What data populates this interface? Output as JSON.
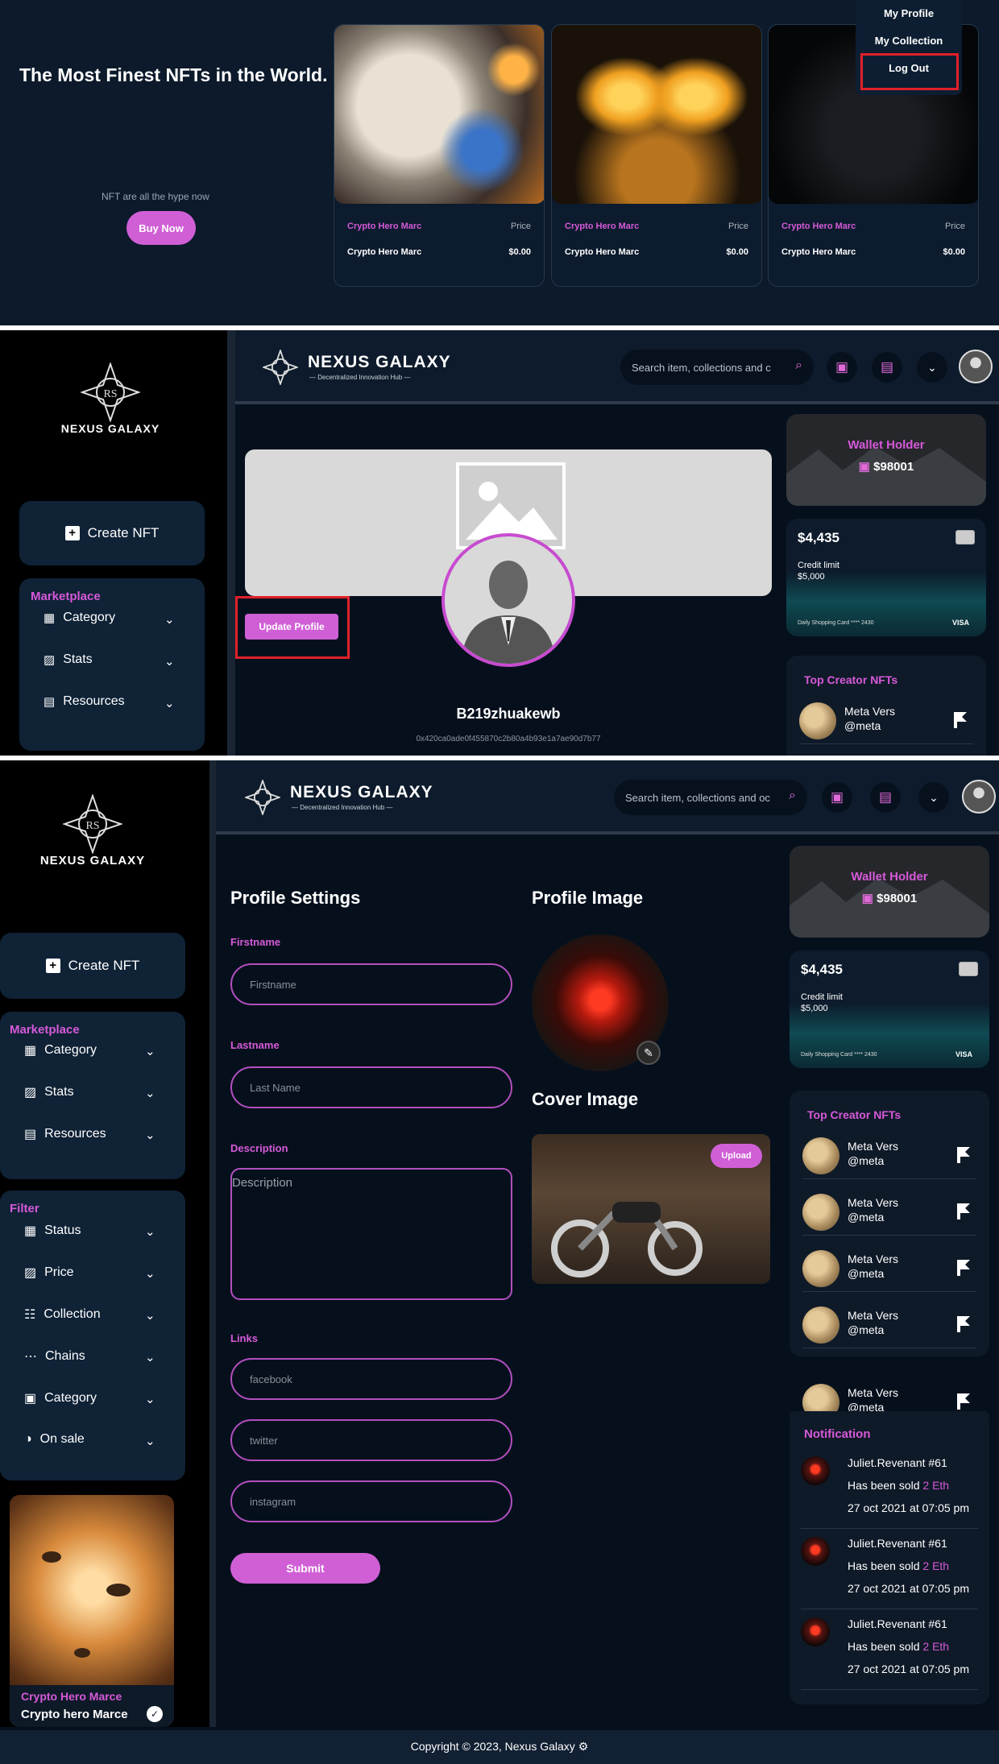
{
  "hero": {
    "title": "The Most Finest NFTs in the World.",
    "subtitle": "NFT are all the hype now",
    "buy_label": "Buy Now",
    "cards": [
      {
        "name": "Crypto Hero Marc",
        "price_label": "Price",
        "owner": "Crypto Hero Marc",
        "price": "$0.00"
      },
      {
        "name": "Crypto Hero Marc",
        "price_label": "Price",
        "owner": "Crypto Hero Marc",
        "price": "$0.00"
      },
      {
        "name": "Crypto Hero Marc",
        "price_label": "Price",
        "owner": "Crypto Hero Marc",
        "price": "$0.00"
      }
    ],
    "menu": {
      "my_profile": "My Profile",
      "my_collection": "My Collection",
      "log_out": "Log Out"
    }
  },
  "brand": {
    "name": "NEXUS GALAXY",
    "tagline": "— Decentralized Innovation Hub —",
    "monogram": "RS"
  },
  "search": {
    "placeholder": "Search item, collections and c",
    "placeholder_full": "Search item, collections and oc"
  },
  "sidebar": {
    "create_label": "Create NFT",
    "marketplace_title": "Marketplace",
    "marketplace_items": [
      {
        "label": "Category",
        "icon": "grid-icon"
      },
      {
        "label": "Stats",
        "icon": "chart-icon"
      },
      {
        "label": "Resources",
        "icon": "document-icon"
      }
    ],
    "filter_title": "Filter",
    "filter_items": [
      {
        "label": "Status",
        "icon": "grid-icon"
      },
      {
        "label": "Price",
        "icon": "chart-icon"
      },
      {
        "label": "Collection",
        "icon": "users-icon"
      },
      {
        "label": "Chains",
        "icon": "dots-icon"
      },
      {
        "label": "Category",
        "icon": "bag-icon"
      },
      {
        "label": "On sale",
        "icon": "sale-icon"
      }
    ],
    "promo": {
      "title": "Crypto Hero Marce",
      "subtitle": "Crypto hero Marce"
    }
  },
  "wallet": {
    "title": "Wallet Holder",
    "amount": "$98001"
  },
  "credit_card": {
    "balance": "$4,435",
    "limit_label": "Credit limit",
    "limit": "$5,000",
    "footer": "Daily Shopping Card **** 2430",
    "brand": "VISA"
  },
  "profile": {
    "update_label": "Update Profile",
    "username": "B219zhuakewb",
    "address": "0x420ca0ade0f455870c2b80a4b93e1a7ae90d7b77"
  },
  "top_creators": {
    "title": "Top Creator NFTs",
    "items": [
      {
        "name": "Meta Vers",
        "handle": "@meta"
      },
      {
        "name": "Meta Vers",
        "handle": "@meta"
      },
      {
        "name": "Meta Vers",
        "handle": "@meta"
      },
      {
        "name": "Meta Vers",
        "handle": "@meta"
      },
      {
        "name": "Meta Vers",
        "handle": "@meta"
      }
    ]
  },
  "settings": {
    "title": "Profile Settings",
    "firstname_label": "Firstname",
    "firstname_placeholder": "Firstname",
    "lastname_label": "Lastname",
    "lastname_placeholder": "Last Name",
    "description_label": "Description",
    "description_placeholder": "Description",
    "links_label": "Links",
    "facebook_placeholder": "facebook",
    "twitter_placeholder": "twitter",
    "instagram_placeholder": "instagram",
    "submit_label": "Submit",
    "profile_image_title": "Profile Image",
    "cover_image_title": "Cover Image",
    "upload_label": "Upload"
  },
  "notifications": {
    "title": "Notification",
    "items": [
      {
        "title": "Juliet.Revenant #61",
        "text": "Has been sold",
        "amount": "2 Eth",
        "time": "27 oct 2021 at 07:05 pm"
      },
      {
        "title": "Juliet.Revenant #61",
        "text": "Has been sold",
        "amount": "2 Eth",
        "time": "27 oct 2021 at 07:05 pm"
      },
      {
        "title": "Juliet.Revenant #61",
        "text": "Has been sold",
        "amount": "2 Eth",
        "time": "27 oct 2021 at 07:05 pm"
      }
    ]
  },
  "footer": {
    "copyright": "Copyright © 2023, Nexus Galaxy"
  },
  "colors": {
    "accent": "#d05fd6",
    "background": "#06101d",
    "panel": "#0f2236",
    "highlight": "#e0202a"
  }
}
